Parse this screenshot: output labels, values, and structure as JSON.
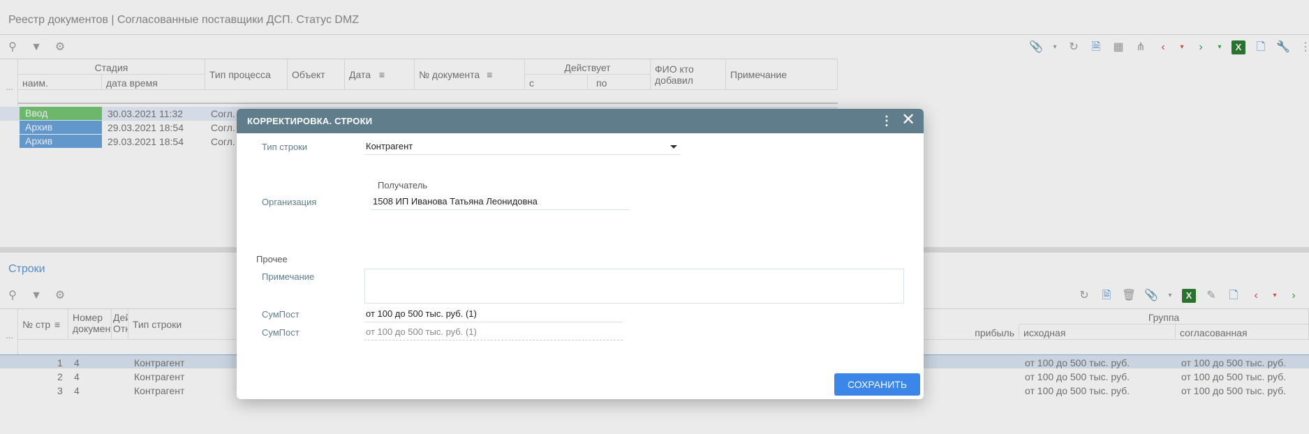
{
  "window": {
    "title": "Реестр документов | Согласованные поставщики ДСП. Статус DMZ"
  },
  "top_grid": {
    "group_headers": {
      "stage": "Стадия",
      "active": "Действует"
    },
    "columns": {
      "dots": "...",
      "name": "наим.",
      "datetime": "дата время",
      "process_type": "Тип процесса",
      "object": "Объект",
      "date": "Дата",
      "doc_number": "№ документа",
      "from": "с",
      "to": "по",
      "added_by": "ФИО кто добавил",
      "note": "Примечание"
    },
    "rows": [
      {
        "stage": "Ввод",
        "stage_color": "#76c776",
        "datetime": "30.03.2021 11:32",
        "process": "Согл."
      },
      {
        "stage": "Архив",
        "stage_color": "#6ba4dd",
        "datetime": "29.03.2021 18:54",
        "process": "Согл."
      },
      {
        "stage": "Архив",
        "stage_color": "#6ba4dd",
        "datetime": "29.03.2021 18:54",
        "process": "Согл."
      }
    ]
  },
  "bottom_section": {
    "title": "Строки",
    "columns": {
      "dots": "...",
      "row_num": "№ стр",
      "doc_num": "Номер документа",
      "det": "Дей Отн",
      "row_type": "Тип строки",
      "profit": "прибыль",
      "group": "Группа",
      "source": "исходная",
      "agreed": "согласованная"
    },
    "rows": [
      {
        "n": "1",
        "doc": "4",
        "type": "Контрагент",
        "source": "от 100 до 500 тыс. руб.",
        "agreed": "от 100 до 500 тыс. руб.",
        "selected": true
      },
      {
        "n": "2",
        "doc": "4",
        "type": "Контрагент",
        "source": "от 100 до 500 тыс. руб.",
        "agreed": "от 100 до 500 тыс. руб.",
        "selected": false
      },
      {
        "n": "3",
        "doc": "4",
        "type": "Контрагент",
        "source": "от 100 до 500 тыс. руб.",
        "agreed": "от 100 до 500 тыс. руб.",
        "selected": false
      }
    ]
  },
  "modal": {
    "title": "КОРРЕКТИРОВКА. СТРОКИ",
    "row_type_label": "Тип строки",
    "row_type_value": "Контрагент",
    "recipient_heading": "Получатель",
    "org_label": "Организация",
    "org_value": "1508 ИП Иванова Татьяна Леонидовна",
    "other_heading": "Прочее",
    "note_label": "Примечание",
    "note_value": "",
    "sum_label_1": "СумПост",
    "sum_value_1": "от 100 до 500 тыс. руб. (1)",
    "sum_label_2": "СумПост",
    "sum_value_2": "от 100 до 500 тыс. руб. (1)",
    "save_label": "СОХРАНИТЬ"
  }
}
